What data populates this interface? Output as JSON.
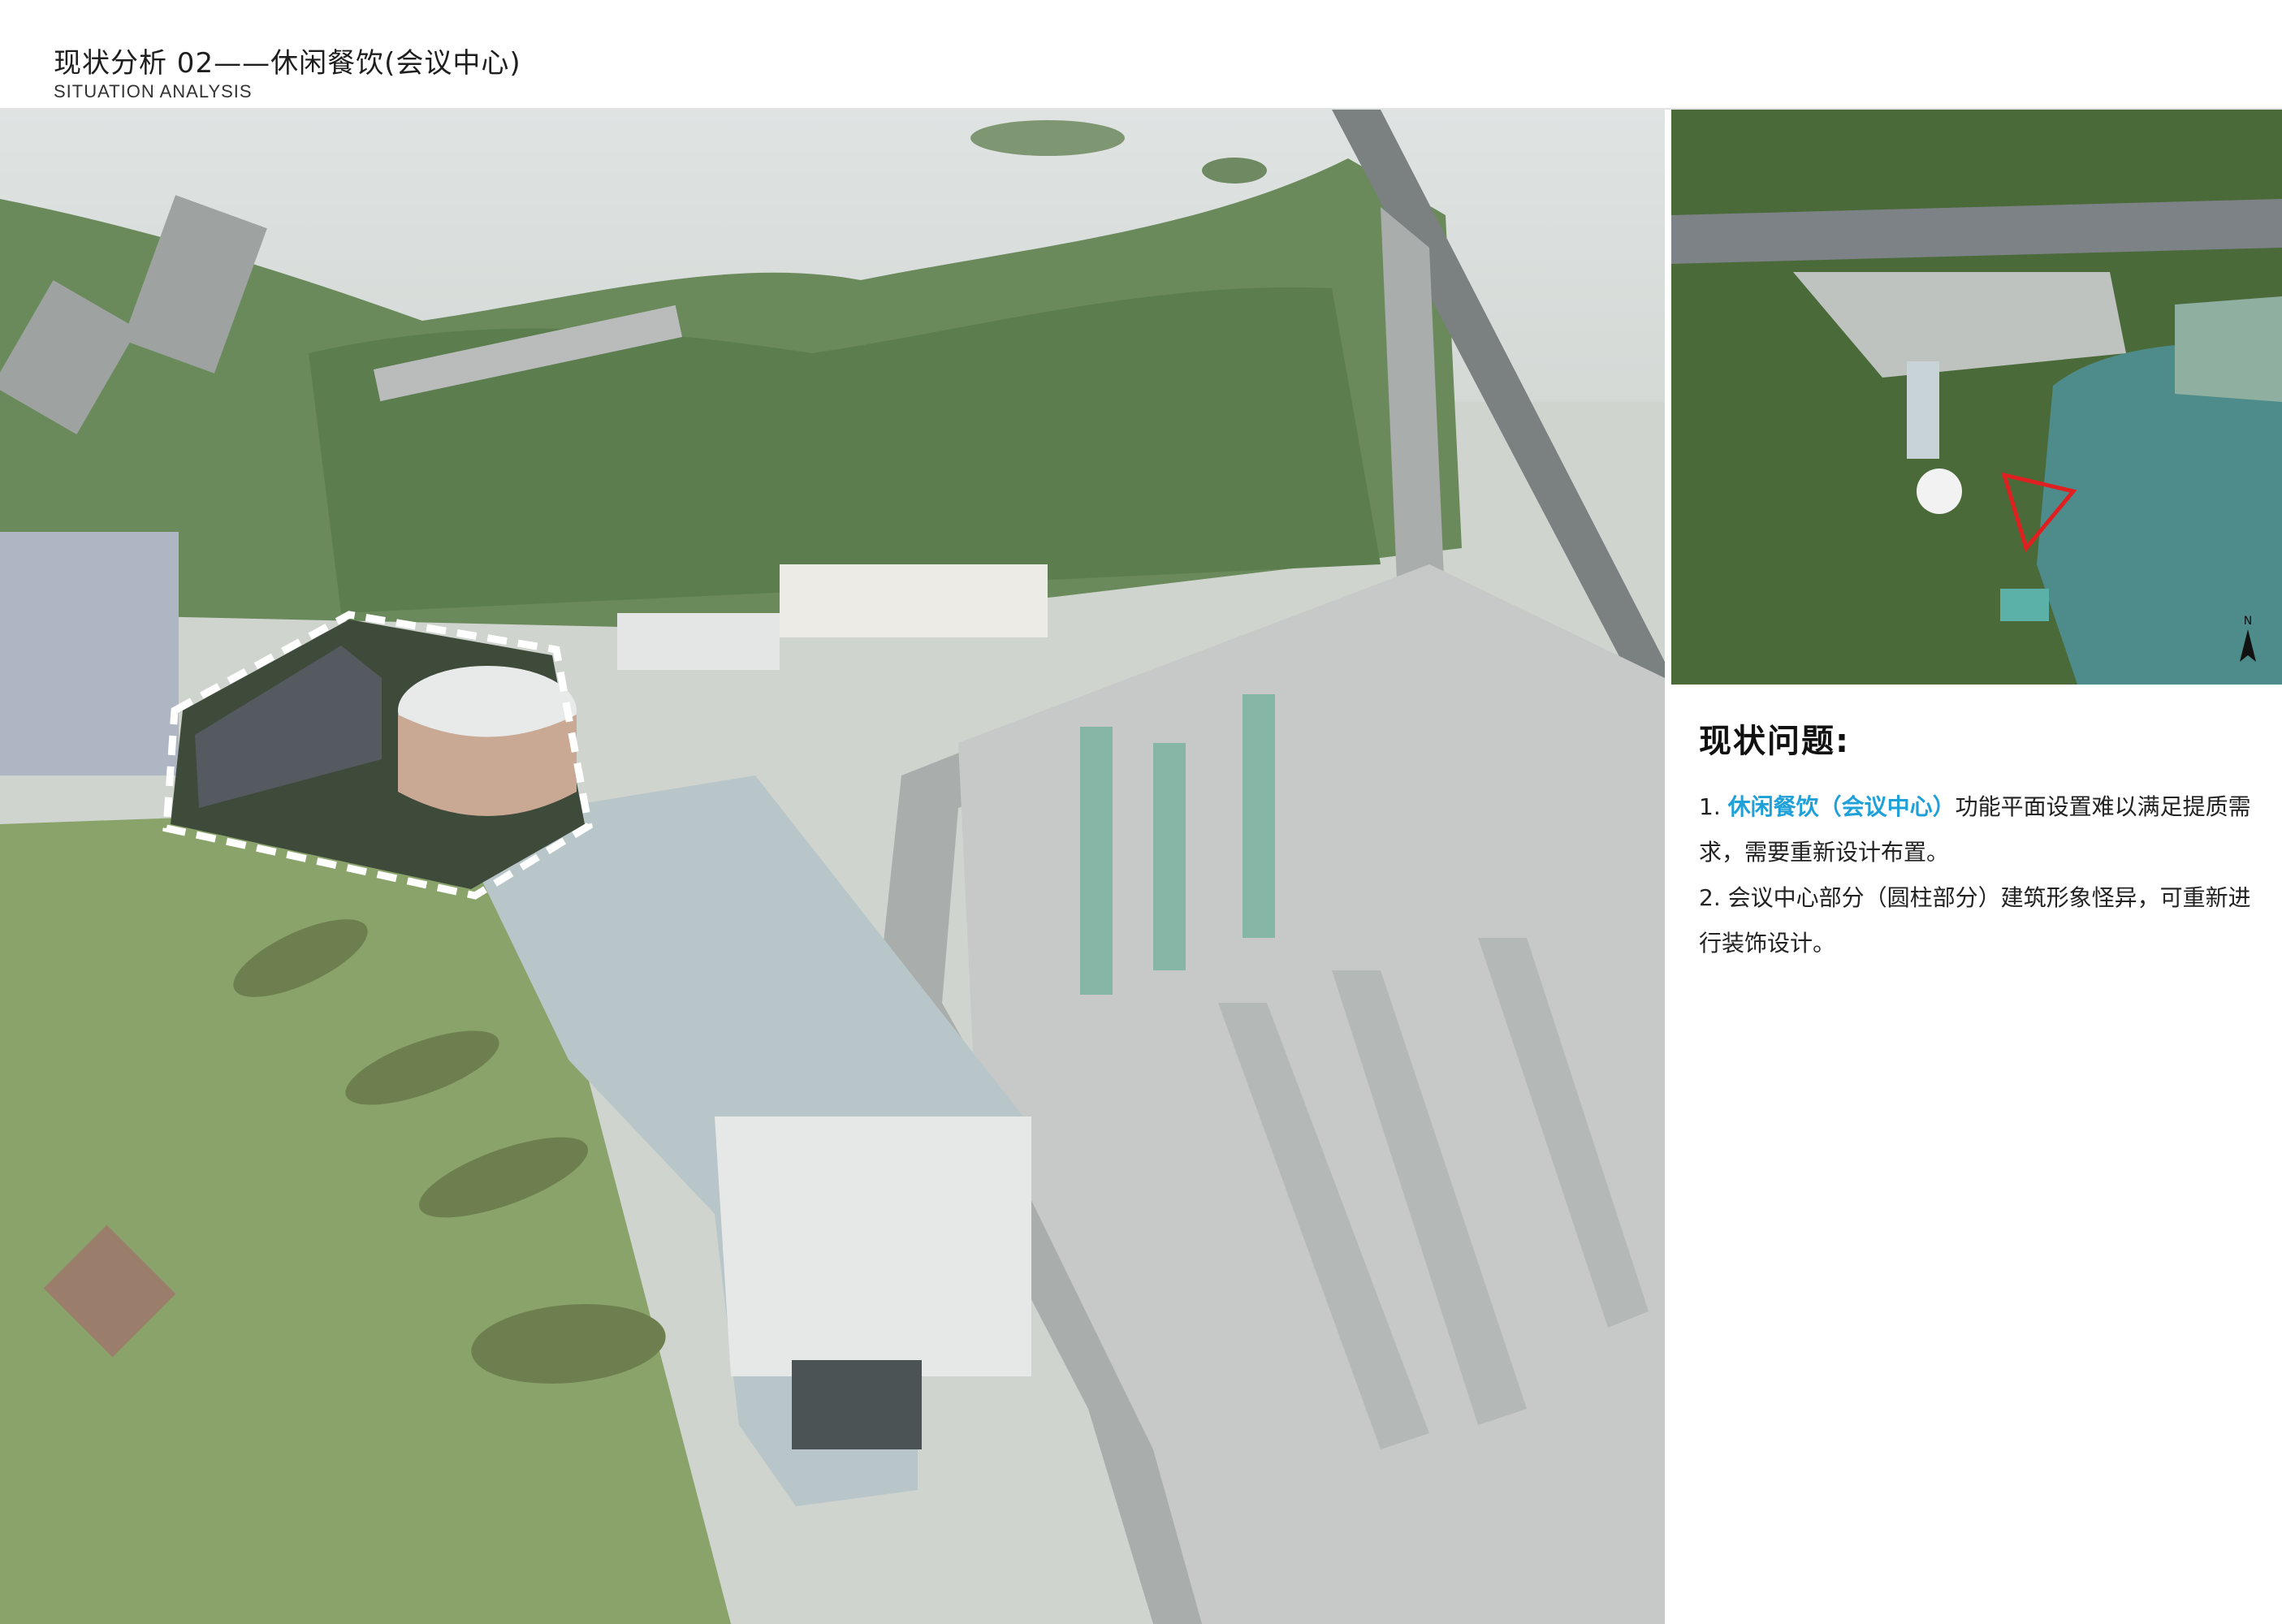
{
  "header": {
    "title": "现状分析 02——休闲餐饮(会议中心)",
    "subtitle": "SITUATION ANALYSIS"
  },
  "aerial_photo": {
    "description_icon": "aerial-photo",
    "highlight_color": "#ffffff"
  },
  "minimap": {
    "north_label": "N",
    "marker_color": "#e02020"
  },
  "panel": {
    "title": "现状问题:",
    "issues": [
      {
        "prefix": "1. ",
        "highlight": "休闲餐饮（会议中心）",
        "text": "功能平面设置难以满足提质需求，需要重新设计布置。"
      },
      {
        "prefix": "2. ",
        "text": "会议中心部分（圆柱部分）建筑形象怪异，可重新进行装饰设计。"
      }
    ],
    "highlight_color": "#1fa0d8"
  }
}
